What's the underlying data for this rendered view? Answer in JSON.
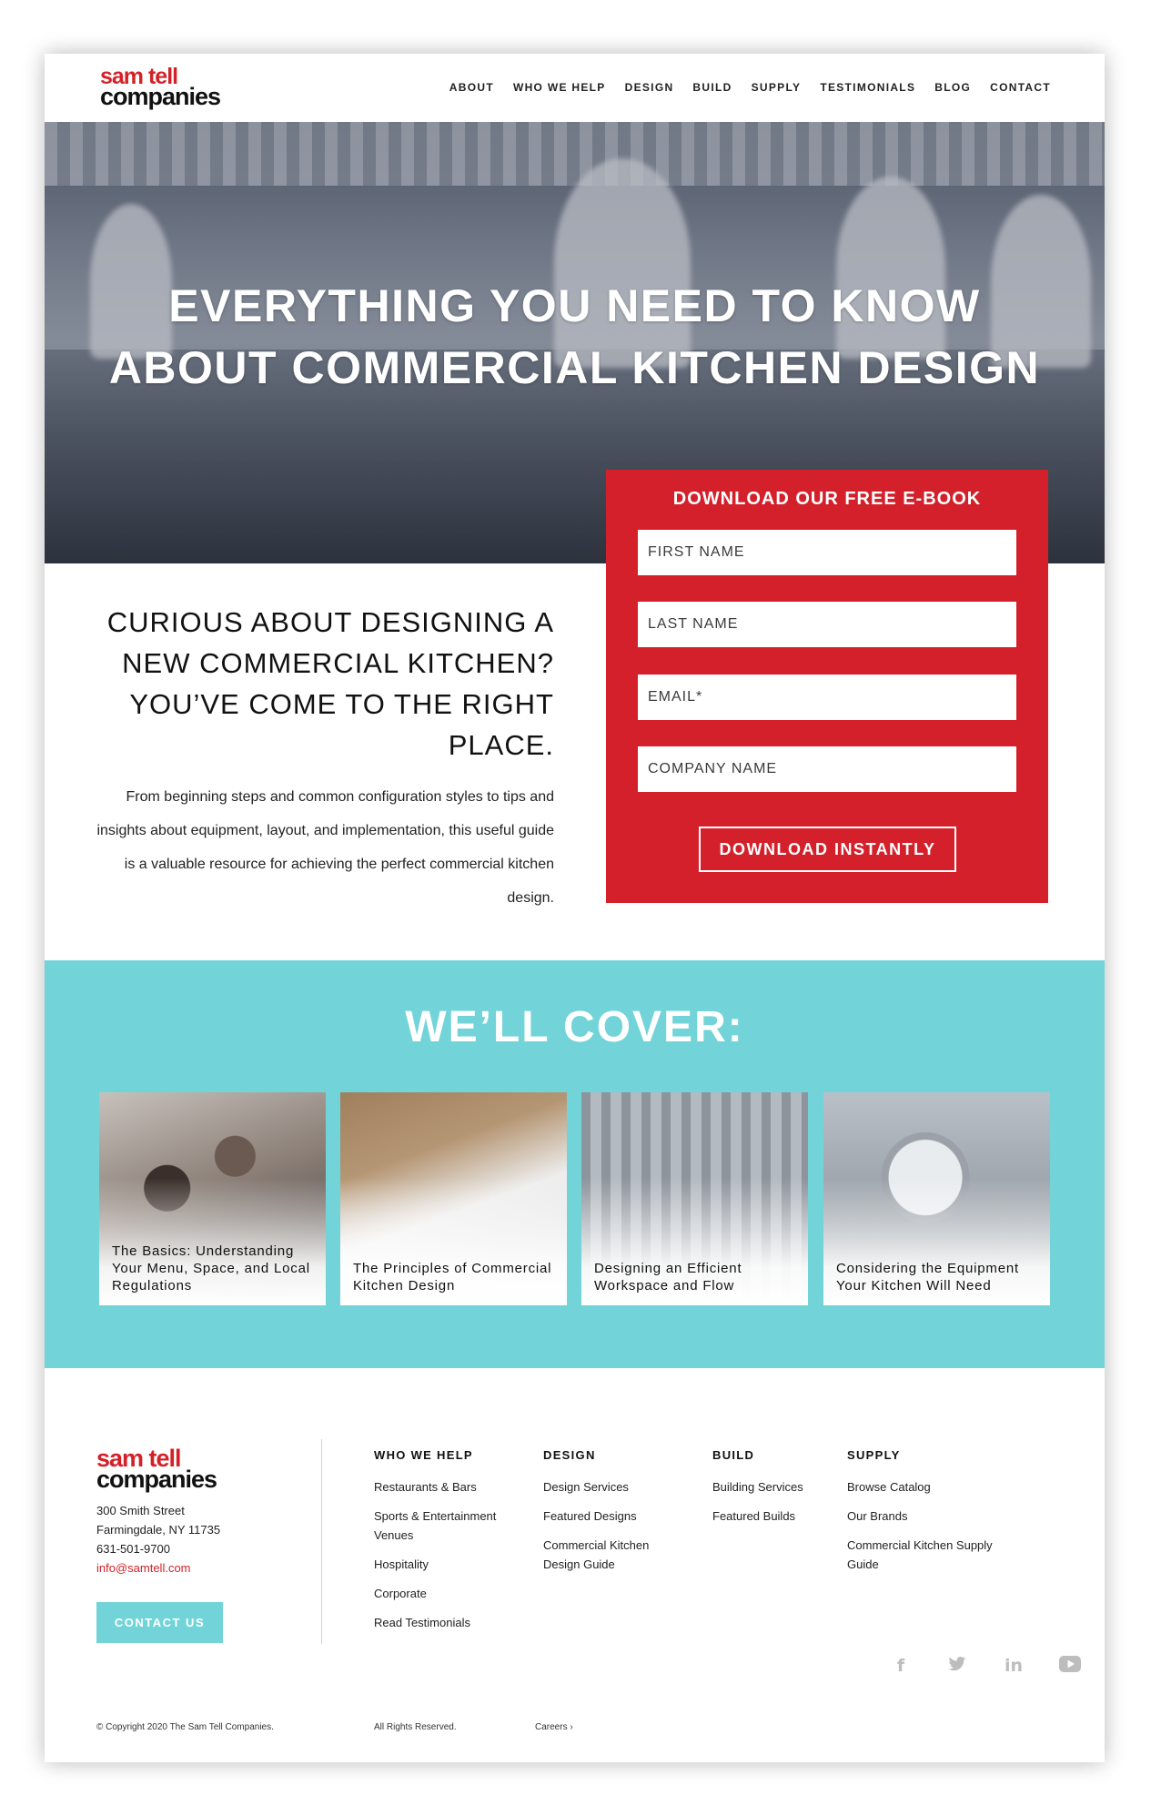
{
  "header": {
    "logo_top": "sam tell",
    "logo_bottom": "companies",
    "nav": [
      "ABOUT",
      "WHO WE HELP",
      "DESIGN",
      "BUILD",
      "SUPPLY",
      "TESTIMONIALS",
      "BLOG",
      "CONTACT"
    ]
  },
  "hero": {
    "title_line1": "EVERYTHING YOU NEED TO KNOW",
    "title_line2": "ABOUT COMMERCIAL KITCHEN DESIGN"
  },
  "form": {
    "title": "DOWNLOAD OUR FREE E-BOOK",
    "first_name_placeholder": "FIRST NAME",
    "last_name_placeholder": "LAST NAME",
    "email_placeholder": "EMAIL*",
    "company_placeholder": "COMPANY NAME",
    "button": "DOWNLOAD INSTANTLY"
  },
  "intro": {
    "heading": "CURIOUS ABOUT DESIGNING A NEW COMMERCIAL KITCHEN? YOU’VE COME TO THE RIGHT PLACE.",
    "body": "From beginning steps and common configuration styles to tips and insights about equipment, layout, and implementation, this useful guide is a valuable resource for achieving the perfect commercial kitchen design."
  },
  "cover": {
    "title": "WE’LL COVER:",
    "cards": [
      "The Basics: Understanding Your Menu, Space, and Local Regulations",
      "The Principles of Commercial Kitchen Design",
      "Designing an Efficient Workspace and Flow",
      "Considering the Equipment Your Kitchen Will Need"
    ]
  },
  "footer": {
    "logo_top": "sam tell",
    "logo_bottom": "companies",
    "address1": "300 Smith Street",
    "address2": "Farmingdale, NY 11735",
    "phone": "631-501-9700",
    "email": "info@samtell.com",
    "contact_button": "CONTACT US",
    "columns": {
      "who": {
        "title": "WHO WE HELP",
        "links": [
          "Restaurants & Bars",
          "Sports & Entertainment Venues",
          "Hospitality",
          "Corporate",
          "Read Testimonials"
        ]
      },
      "design": {
        "title": "DESIGN",
        "links": [
          "Design Services",
          "Featured Designs",
          "Commercial Kitchen Design Guide"
        ]
      },
      "build": {
        "title": "BUILD",
        "links": [
          "Building Services",
          "Featured Builds"
        ]
      },
      "supply": {
        "title": "SUPPLY",
        "links": [
          "Browse Catalog",
          "Our Brands",
          "Commercial Kitchen Supply Guide"
        ]
      }
    },
    "social_icons": [
      "facebook-icon",
      "twitter-icon",
      "linkedin-icon",
      "youtube-icon"
    ],
    "copyright": "© Copyright 2020 The Sam Tell Companies.",
    "rights": "All Rights Reserved.",
    "careers": "Careers ›"
  },
  "colors": {
    "brand_red": "#d3202a",
    "teal": "#72d4d8"
  }
}
